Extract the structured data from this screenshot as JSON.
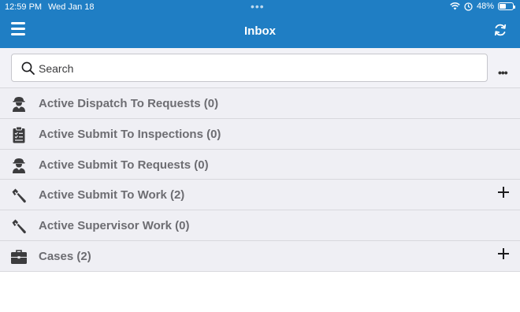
{
  "status_bar": {
    "time": "12:59 PM",
    "date": "Wed Jan 18",
    "battery_text": "48%",
    "battery_level": 0.48
  },
  "header": {
    "title": "Inbox"
  },
  "search": {
    "placeholder": "Search",
    "value": ""
  },
  "list": [
    {
      "label": "Active Dispatch To Requests (0)",
      "icon": "worker-icon",
      "has_add": false
    },
    {
      "label": "Active Submit To Inspections (0)",
      "icon": "clipboard-icon",
      "has_add": false
    },
    {
      "label": "Active Submit To Requests (0)",
      "icon": "worker-icon",
      "has_add": false
    },
    {
      "label": "Active Submit To Work (2)",
      "icon": "wrench-icon",
      "has_add": true
    },
    {
      "label": "Active Supervisor Work (0)",
      "icon": "wrench-icon",
      "has_add": false
    },
    {
      "label": "Cases (2)",
      "icon": "briefcase-icon",
      "has_add": true
    }
  ],
  "colors": {
    "header_bg": "#1f7ec4",
    "list_bg": "#efeff4",
    "label_text": "#6d6d72",
    "icon_color": "#3c3c3e"
  }
}
